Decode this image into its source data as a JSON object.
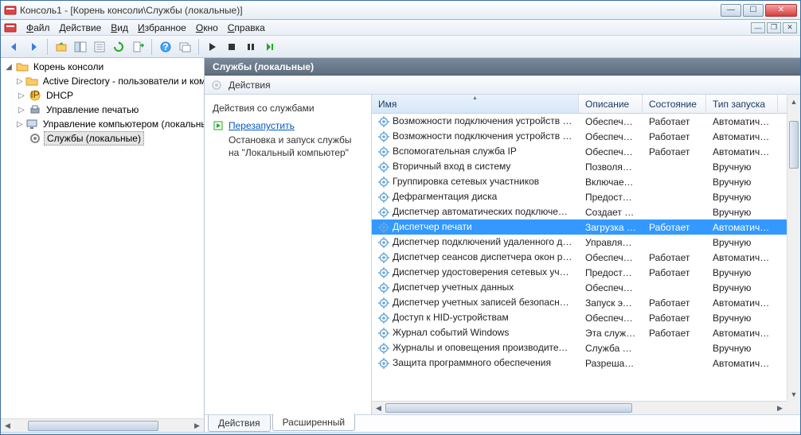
{
  "window": {
    "title": "Консоль1 - [Корень консоли\\Службы (локальные)]"
  },
  "menu": {
    "file": "Файл",
    "action": "Действие",
    "view": "Вид",
    "fav": "Избранное",
    "window": "Окно",
    "help": "Справка"
  },
  "tree": {
    "root": "Корень консоли",
    "items": [
      {
        "label": "Active Directory - пользователи и компьютеры",
        "icon": "folder"
      },
      {
        "label": "DHCP",
        "icon": "dhcp"
      },
      {
        "label": "Управление печатью",
        "icon": "printer"
      },
      {
        "label": "Управление компьютером (локальным)",
        "icon": "computer"
      },
      {
        "label": "Службы (локальные)",
        "icon": "gear",
        "selected": true
      }
    ]
  },
  "detail": {
    "header": "Службы (локальные)",
    "actions_label": "Действия",
    "task": {
      "title": "Действия со службами",
      "link": "Перезапустить",
      "desc": "Остановка и запуск службы на \"Локальный компьютер\""
    },
    "columns": {
      "name": "Имя",
      "desc": "Описание",
      "state": "Состояние",
      "start": "Тип запуска"
    },
    "rows": [
      {
        "name": "Возможности подключения устройств …",
        "desc": "Обеспечи…",
        "state": "Работает",
        "start": "Автоматиче…"
      },
      {
        "name": "Возможности подключения устройств …",
        "desc": "Обеспечи…",
        "state": "Работает",
        "start": "Автоматиче…"
      },
      {
        "name": "Вспомогательная служба IP",
        "desc": "Обеспечи…",
        "state": "Работает",
        "start": "Автоматиче…"
      },
      {
        "name": "Вторичный вход в систему",
        "desc": "Позволяет…",
        "state": "",
        "start": "Вручную"
      },
      {
        "name": "Группировка сетевых участников",
        "desc": "Включает …",
        "state": "",
        "start": "Вручную"
      },
      {
        "name": "Дефрагментация диска",
        "desc": "Предостав…",
        "state": "",
        "start": "Вручную"
      },
      {
        "name": "Диспетчер автоматических подключен…",
        "desc": "Создает п…",
        "state": "",
        "start": "Вручную"
      },
      {
        "name": "Диспетчер печати",
        "desc": "Загрузка …",
        "state": "Работает",
        "start": "Автоматиче…",
        "selected": true
      },
      {
        "name": "Диспетчер подключений удаленного д…",
        "desc": "Управляет…",
        "state": "",
        "start": "Вручную"
      },
      {
        "name": "Диспетчер сеансов диспетчера окон ра…",
        "desc": "Обеспечи…",
        "state": "Работает",
        "start": "Автоматиче…"
      },
      {
        "name": "Диспетчер удостоверения сетевых учас…",
        "desc": "Предостав…",
        "state": "Работает",
        "start": "Вручную"
      },
      {
        "name": "Диспетчер учетных данных",
        "desc": "Обеспечи…",
        "state": "",
        "start": "Вручную"
      },
      {
        "name": "Диспетчер учетных записей безопасност…",
        "desc": "Запуск это…",
        "state": "Работает",
        "start": "Автоматиче…"
      },
      {
        "name": "Доступ к HID-устройствам",
        "desc": "Обеспечи…",
        "state": "Работает",
        "start": "Вручную"
      },
      {
        "name": "Журнал событий Windows",
        "desc": "Эта служб…",
        "state": "Работает",
        "start": "Автоматиче…"
      },
      {
        "name": "Журналы и оповещения производител…",
        "desc": "Служба ж…",
        "state": "",
        "start": "Вручную"
      },
      {
        "name": "Защита программного обеспечения",
        "desc": "Разрешает…",
        "state": "",
        "start": "Автоматиче…"
      }
    ],
    "tabs": {
      "actions": "Действия",
      "extended": "Расширенный"
    }
  }
}
